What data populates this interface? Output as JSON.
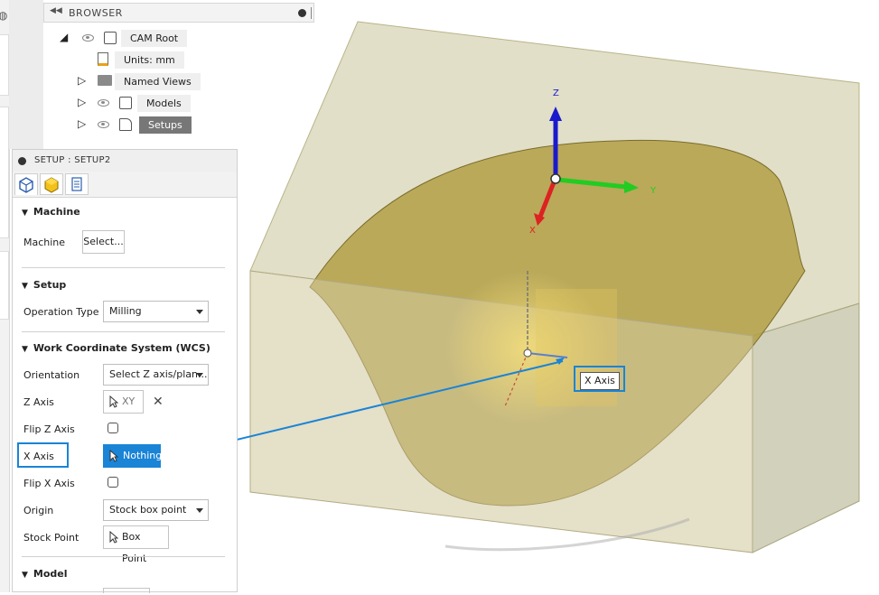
{
  "browser": {
    "title": "BROWSER",
    "items": [
      {
        "label": "CAM Root"
      },
      {
        "label": "Units: mm"
      },
      {
        "label": "Named Views"
      },
      {
        "label": "Models"
      },
      {
        "label": "Setups"
      }
    ]
  },
  "panel": {
    "title": "SETUP : SETUP2",
    "machine": {
      "section": "Machine",
      "label": "Machine",
      "button": "Select..."
    },
    "setup": {
      "section": "Setup",
      "operation_type_label": "Operation Type",
      "operation_type_value": "Milling"
    },
    "wcs": {
      "section": "Work Coordinate System (WCS)",
      "orientation_label": "Orientation",
      "orientation_value": "Select Z axis/plan...",
      "z_axis_label": "Z Axis",
      "z_axis_value": "XY",
      "flip_z_label": "Flip Z Axis",
      "x_axis_label": "X Axis",
      "x_axis_value": "Nothing",
      "flip_x_label": "Flip X Axis",
      "origin_label": "Origin",
      "origin_value": "Stock box point",
      "stock_point_label": "Stock Point",
      "stock_point_value": "Box Point"
    },
    "model": {
      "section": "Model"
    }
  },
  "viewport": {
    "tooltip": "X Axis",
    "axis_z": "Z",
    "axis_y": "Y",
    "axis_x": "X"
  },
  "colors": {
    "accent": "#1a84d6",
    "stock": "#c8c49a",
    "surface": "#b3a045",
    "axis_z": "#1a1acc",
    "axis_y": "#22cc22",
    "axis_x": "#dd2222"
  }
}
